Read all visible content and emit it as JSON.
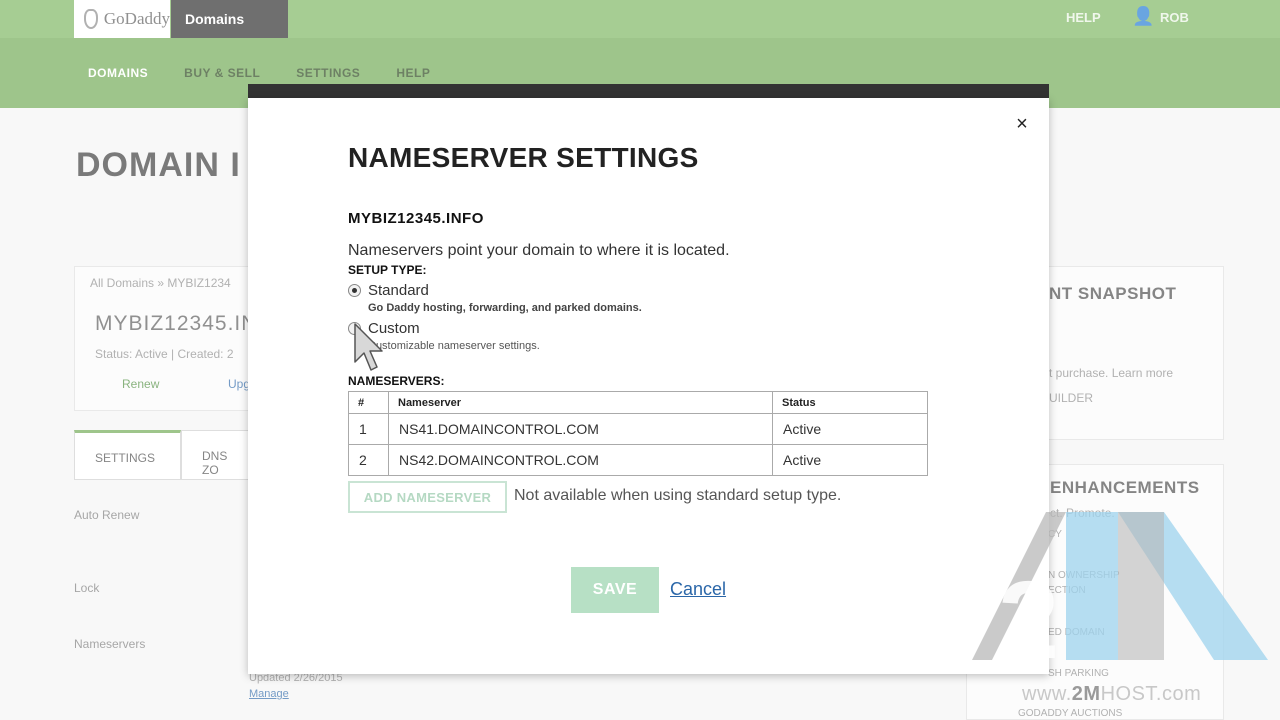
{
  "background": {
    "logo": "GoDaddy",
    "product": "Domains",
    "help_top": "HELP",
    "user": "ROB",
    "nav": [
      "DOMAINS",
      "BUY & SELL",
      "SETTINGS",
      "HELP"
    ],
    "page_title": "DOMAIN I",
    "breadcrumb": "All Domains » MYBIZ1234",
    "domain_big": "MYBIZ12345.IN",
    "status_line": "Status: Active  |  Created: 2",
    "renew": "Renew",
    "upgrade": "Upg",
    "tabs": [
      "SETTINGS",
      "DNS ZO"
    ],
    "labels": [
      "Auto Renew",
      "Lock",
      "Nameservers"
    ],
    "updated": "Updated 2/26/2015",
    "manage": "Manage",
    "right_snapshot": "NT SNAPSHOT",
    "right_purchase": "t purchase. Learn more",
    "right_builder": "UILDER",
    "right_enh": "N ENHANCEMENTS",
    "right_enh_sub": "tect. Promote.",
    "right_items": [
      "CY",
      "N OWNERSHIP",
      "ECTION",
      "ED DOMAIN",
      "SH PARKING",
      "GODADDY AUCTIONS"
    ]
  },
  "modal": {
    "title": "NAMESERVER SETTINGS",
    "domain": "MYBIZ12345.INFO",
    "intro": "Nameservers point your domain to where it is located.",
    "setup_type_label": "SETUP TYPE:",
    "options": [
      {
        "label": "Standard",
        "desc": "Go Daddy hosting, forwarding, and parked domains.",
        "checked": true
      },
      {
        "label": "Custom",
        "desc": "Customizable nameserver settings.",
        "checked": false
      }
    ],
    "nameservers_label": "NAMESERVERS:",
    "table": {
      "headers": [
        "#",
        "Nameserver",
        "Status"
      ],
      "rows": [
        [
          "1",
          "NS41.DOMAINCONTROL.COM",
          "Active"
        ],
        [
          "2",
          "NS42.DOMAINCONTROL.COM",
          "Active"
        ]
      ]
    },
    "add_button": "ADD NAMESERVER",
    "add_note": "Not available when using standard setup type.",
    "save": "SAVE",
    "cancel": "Cancel",
    "close": "×"
  },
  "watermark": {
    "prefix": "www.",
    "brand": "2M",
    "suffix": "HOST.com"
  }
}
